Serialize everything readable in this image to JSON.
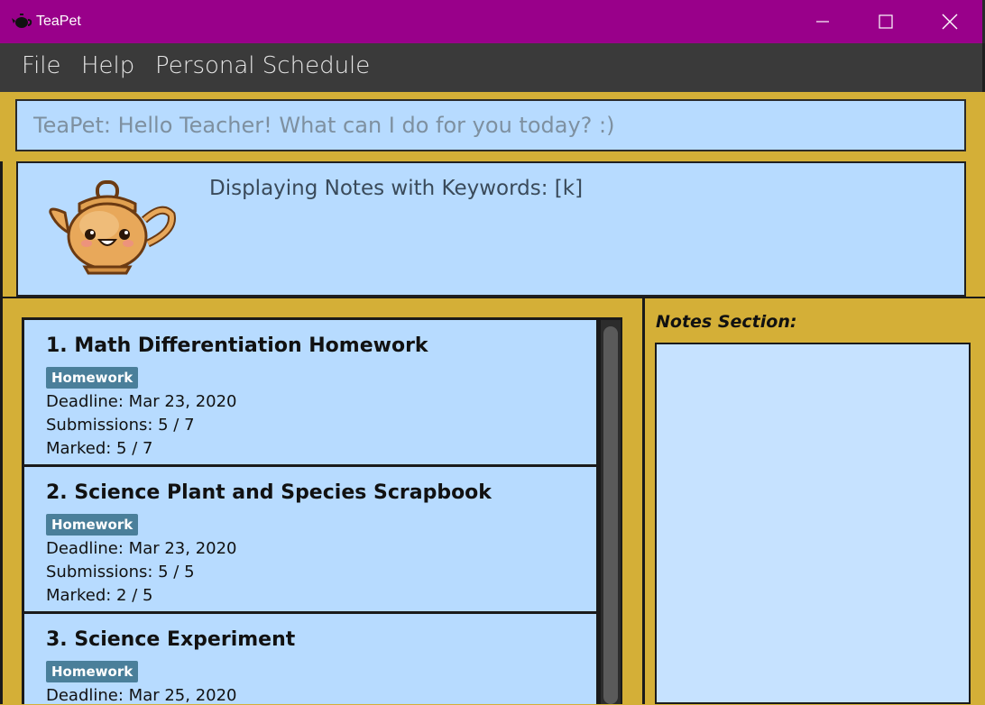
{
  "window": {
    "title": "TeaPet"
  },
  "menu": {
    "file": "File",
    "help": "Help",
    "schedule": "Personal Schedule"
  },
  "command": {
    "placeholder": "TeaPet: Hello Teacher! What can I do for you today? :)"
  },
  "result": {
    "text": "Displaying Notes with Keywords: [k]"
  },
  "notes": {
    "label": "Notes Section:"
  },
  "assignments": [
    {
      "title": "1.  Math Differentiation Homework",
      "tag": "Homework",
      "deadline": "Deadline: Mar 23, 2020",
      "submissions": "Submissions: 5 / 7",
      "marked": "Marked: 5 / 7"
    },
    {
      "title": "2.  Science Plant and Species Scrapbook",
      "tag": "Homework",
      "deadline": "Deadline: Mar 23, 2020",
      "submissions": "Submissions: 5 / 5",
      "marked": "Marked: 2 / 5"
    },
    {
      "title": "3.  Science Experiment",
      "tag": "Homework",
      "deadline": "Deadline: Mar 25, 2020"
    }
  ],
  "colors": {
    "titlebar": "#99008a",
    "menubar": "#3a3a3a",
    "accent_gold": "#d4af37",
    "panel_blue": "#b7dbff",
    "tag": "#4a7f9a"
  },
  "icons": {
    "app": "teapot-icon",
    "minimize": "minimize-icon",
    "maximize": "maximize-icon",
    "close": "close-icon",
    "mascot": "teapot-mascot"
  }
}
